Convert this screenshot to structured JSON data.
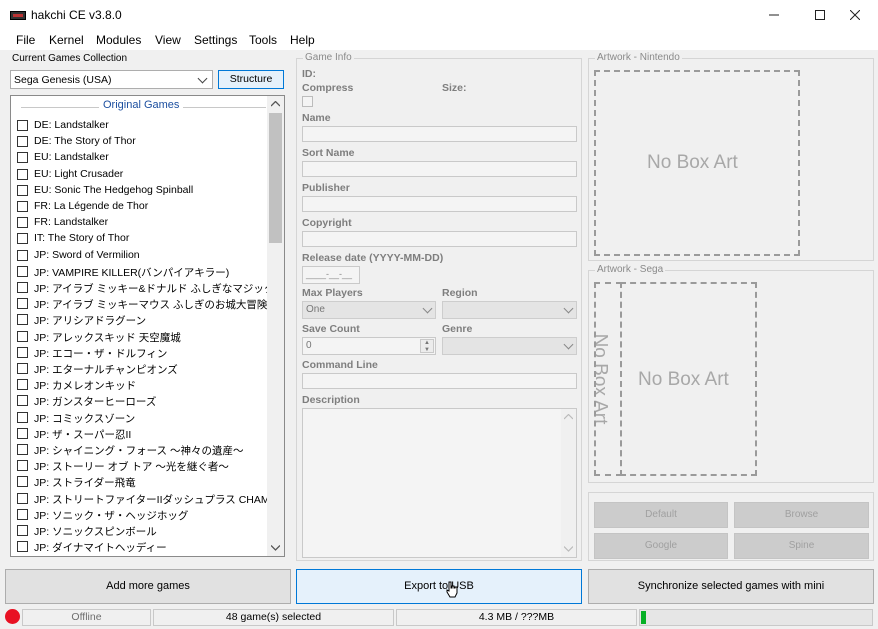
{
  "window": {
    "title": "hakchi CE v3.8.0"
  },
  "menu": [
    "File",
    "Kernel",
    "Modules",
    "View",
    "Settings",
    "Tools",
    "Help"
  ],
  "collection": {
    "label": "Current Games Collection",
    "selected": "Sega Genesis (USA)",
    "structure_button": "Structure"
  },
  "games_list": {
    "header": "Original Games",
    "items": [
      "DE: Landstalker",
      "DE: The Story of Thor",
      "EU: Landstalker",
      "EU: Light Crusader",
      "EU: Sonic The Hedgehog Spinball",
      "FR: La Légende de Thor",
      "FR: Landstalker",
      "IT: The Story of Thor",
      "JP: Sword of Vermilion",
      "JP: VAMPIRE KILLER(バンパイアキラー)",
      "JP: アイラブ ミッキー&ドナルド ふしぎなマジックボッ...",
      "JP: アイラブ ミッキーマウス ふしぎのお城大冒険",
      "JP: アリシアドラグーン",
      "JP: アレックスキッド 天空魔城",
      "JP: エコー・ザ・ドルフィン",
      "JP: エターナルチャンピオンズ",
      "JP: カメレオンキッド",
      "JP: ガンスターヒーローズ",
      "JP: コミックスゾーン",
      "JP: ザ・スーパー忍II",
      "JP: シャイニング・フォース 〜神々の遺産〜",
      "JP: ストーリー オブ トア 〜光を継ぐ者〜",
      "JP: ストライダー飛竜",
      "JP: ストリートファイターIIダッシュプラス CHAMPION E...",
      "JP: ソニック・ザ・ヘッジホッグ",
      "JP: ソニックスピンボール",
      "JP: ダイナマイトヘッディー"
    ]
  },
  "game_info": {
    "title": "Game Info",
    "id_label": "ID:",
    "compress_label": "Compress",
    "size_label": "Size:",
    "name_label": "Name",
    "sort_name_label": "Sort Name",
    "publisher_label": "Publisher",
    "copyright_label": "Copyright",
    "release_label": "Release date (YYYY-MM-DD)",
    "release_mask": "____-__-__",
    "max_players_label": "Max Players",
    "max_players_value": "One",
    "region_label": "Region",
    "save_count_label": "Save Count",
    "save_count_value": "0",
    "genre_label": "Genre",
    "command_line_label": "Command Line",
    "description_label": "Description"
  },
  "artwork_nintendo": {
    "title": "Artwork - Nintendo",
    "placeholder": "No Box Art"
  },
  "artwork_sega": {
    "title": "Artwork - Sega",
    "placeholder": "No Box Art",
    "spine_placeholder": "No Box Art"
  },
  "art_buttons": {
    "default": "Default",
    "browse": "Browse",
    "google": "Google",
    "spine": "Spine"
  },
  "bottom_buttons": {
    "add": "Add more games",
    "export": "Export to USB",
    "sync": "Synchronize selected games with mini"
  },
  "status": {
    "connection": "Offline",
    "selected": "48 game(s) selected",
    "size": "4.3 MB / ???MB",
    "indicator_color": "#e81123",
    "progress_color": "#06b025"
  }
}
